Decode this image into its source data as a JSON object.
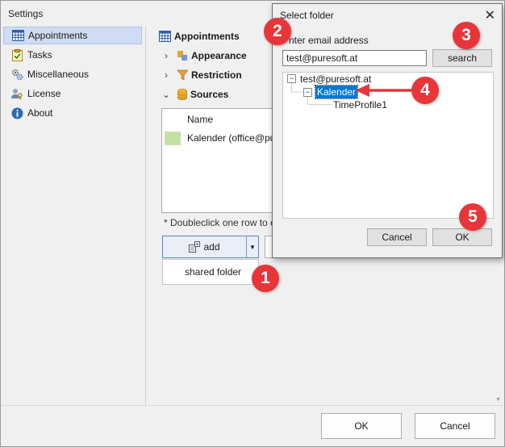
{
  "window": {
    "title": "Settings"
  },
  "sidebar": {
    "items": [
      {
        "label": "Appointments",
        "icon": "calendar-grid-icon",
        "active": true
      },
      {
        "label": "Tasks",
        "icon": "clipboard-check-icon"
      },
      {
        "label": "Miscellaneous",
        "icon": "gears-icon"
      },
      {
        "label": "License",
        "icon": "key-user-icon"
      },
      {
        "label": "About",
        "icon": "info-icon"
      }
    ]
  },
  "main": {
    "heading": "Appointments",
    "sections": [
      {
        "label": "Appearance",
        "chevron": "›",
        "icon": "appearance-icon"
      },
      {
        "label": "Restriction",
        "chevron": "›",
        "icon": "funnel-icon"
      },
      {
        "label": "Sources",
        "chevron": "⌄",
        "icon": "database-icon"
      }
    ],
    "sources_table": {
      "header": "Name",
      "rows": [
        {
          "name": "Kalender (office@pu",
          "color": "#c5e0a5"
        }
      ]
    },
    "hint": "* Doubleclick one row to c",
    "add_button": "add",
    "dropdown_item": "shared folder"
  },
  "footer": {
    "ok": "OK",
    "cancel": "Cancel"
  },
  "dialog": {
    "title": "Select folder",
    "close": "✕",
    "email_label": "nter email address",
    "email_value": "test@puresoft.at",
    "search": "search",
    "tree": {
      "root": "test@puresoft.at",
      "root_toggle": "−",
      "child": "Kalender",
      "child_toggle": "−",
      "grandchild": "TimeProfile1"
    },
    "cancel": "Cancel",
    "ok": "OK"
  },
  "callouts": [
    "1",
    "2",
    "3",
    "4",
    "5"
  ],
  "colors": {
    "accent": "#0078d7",
    "callout": "#e8353a",
    "selection": "#0078d7"
  }
}
